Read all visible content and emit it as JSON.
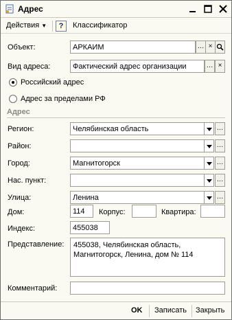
{
  "window": {
    "title": "Адрес"
  },
  "toolbar": {
    "actions_label": "Действия",
    "help_label": "?",
    "classifier_label": "Классификатор"
  },
  "form": {
    "object_label": "Объект:",
    "object_value": "АРКАИМ",
    "address_type_label": "Вид адреса:",
    "address_type_value": "Фактический адрес организации",
    "radio_russian": "Российский адрес",
    "radio_foreign": "Адрес за пределами РФ",
    "address_section": "Адрес",
    "region_label": "Регион:",
    "region_value": "Челябинская область",
    "district_label": "Район:",
    "district_value": "",
    "city_label": "Город:",
    "city_value": "Магнитогорск",
    "locality_label": "Нас. пункт:",
    "locality_value": "",
    "street_label": "Улица:",
    "street_value": "Ленина",
    "house_label": "Дом:",
    "house_value": "114",
    "building_label": "Корпус:",
    "building_value": "",
    "apartment_label": "Квартира:",
    "apartment_value": "",
    "index_label": "Индекс:",
    "index_value": "455038",
    "representation_label": "Представление:",
    "representation_value": "455038, Челябинская область, Магнитогорск, Ленина, дом № 114",
    "comment_label": "Комментарий:",
    "comment_value": ""
  },
  "buttons": {
    "ok": "OK",
    "save": "Записать",
    "close": "Закрыть"
  },
  "icons": {
    "select_button": "…",
    "clear_button": "×",
    "search_button": "search-icon"
  }
}
